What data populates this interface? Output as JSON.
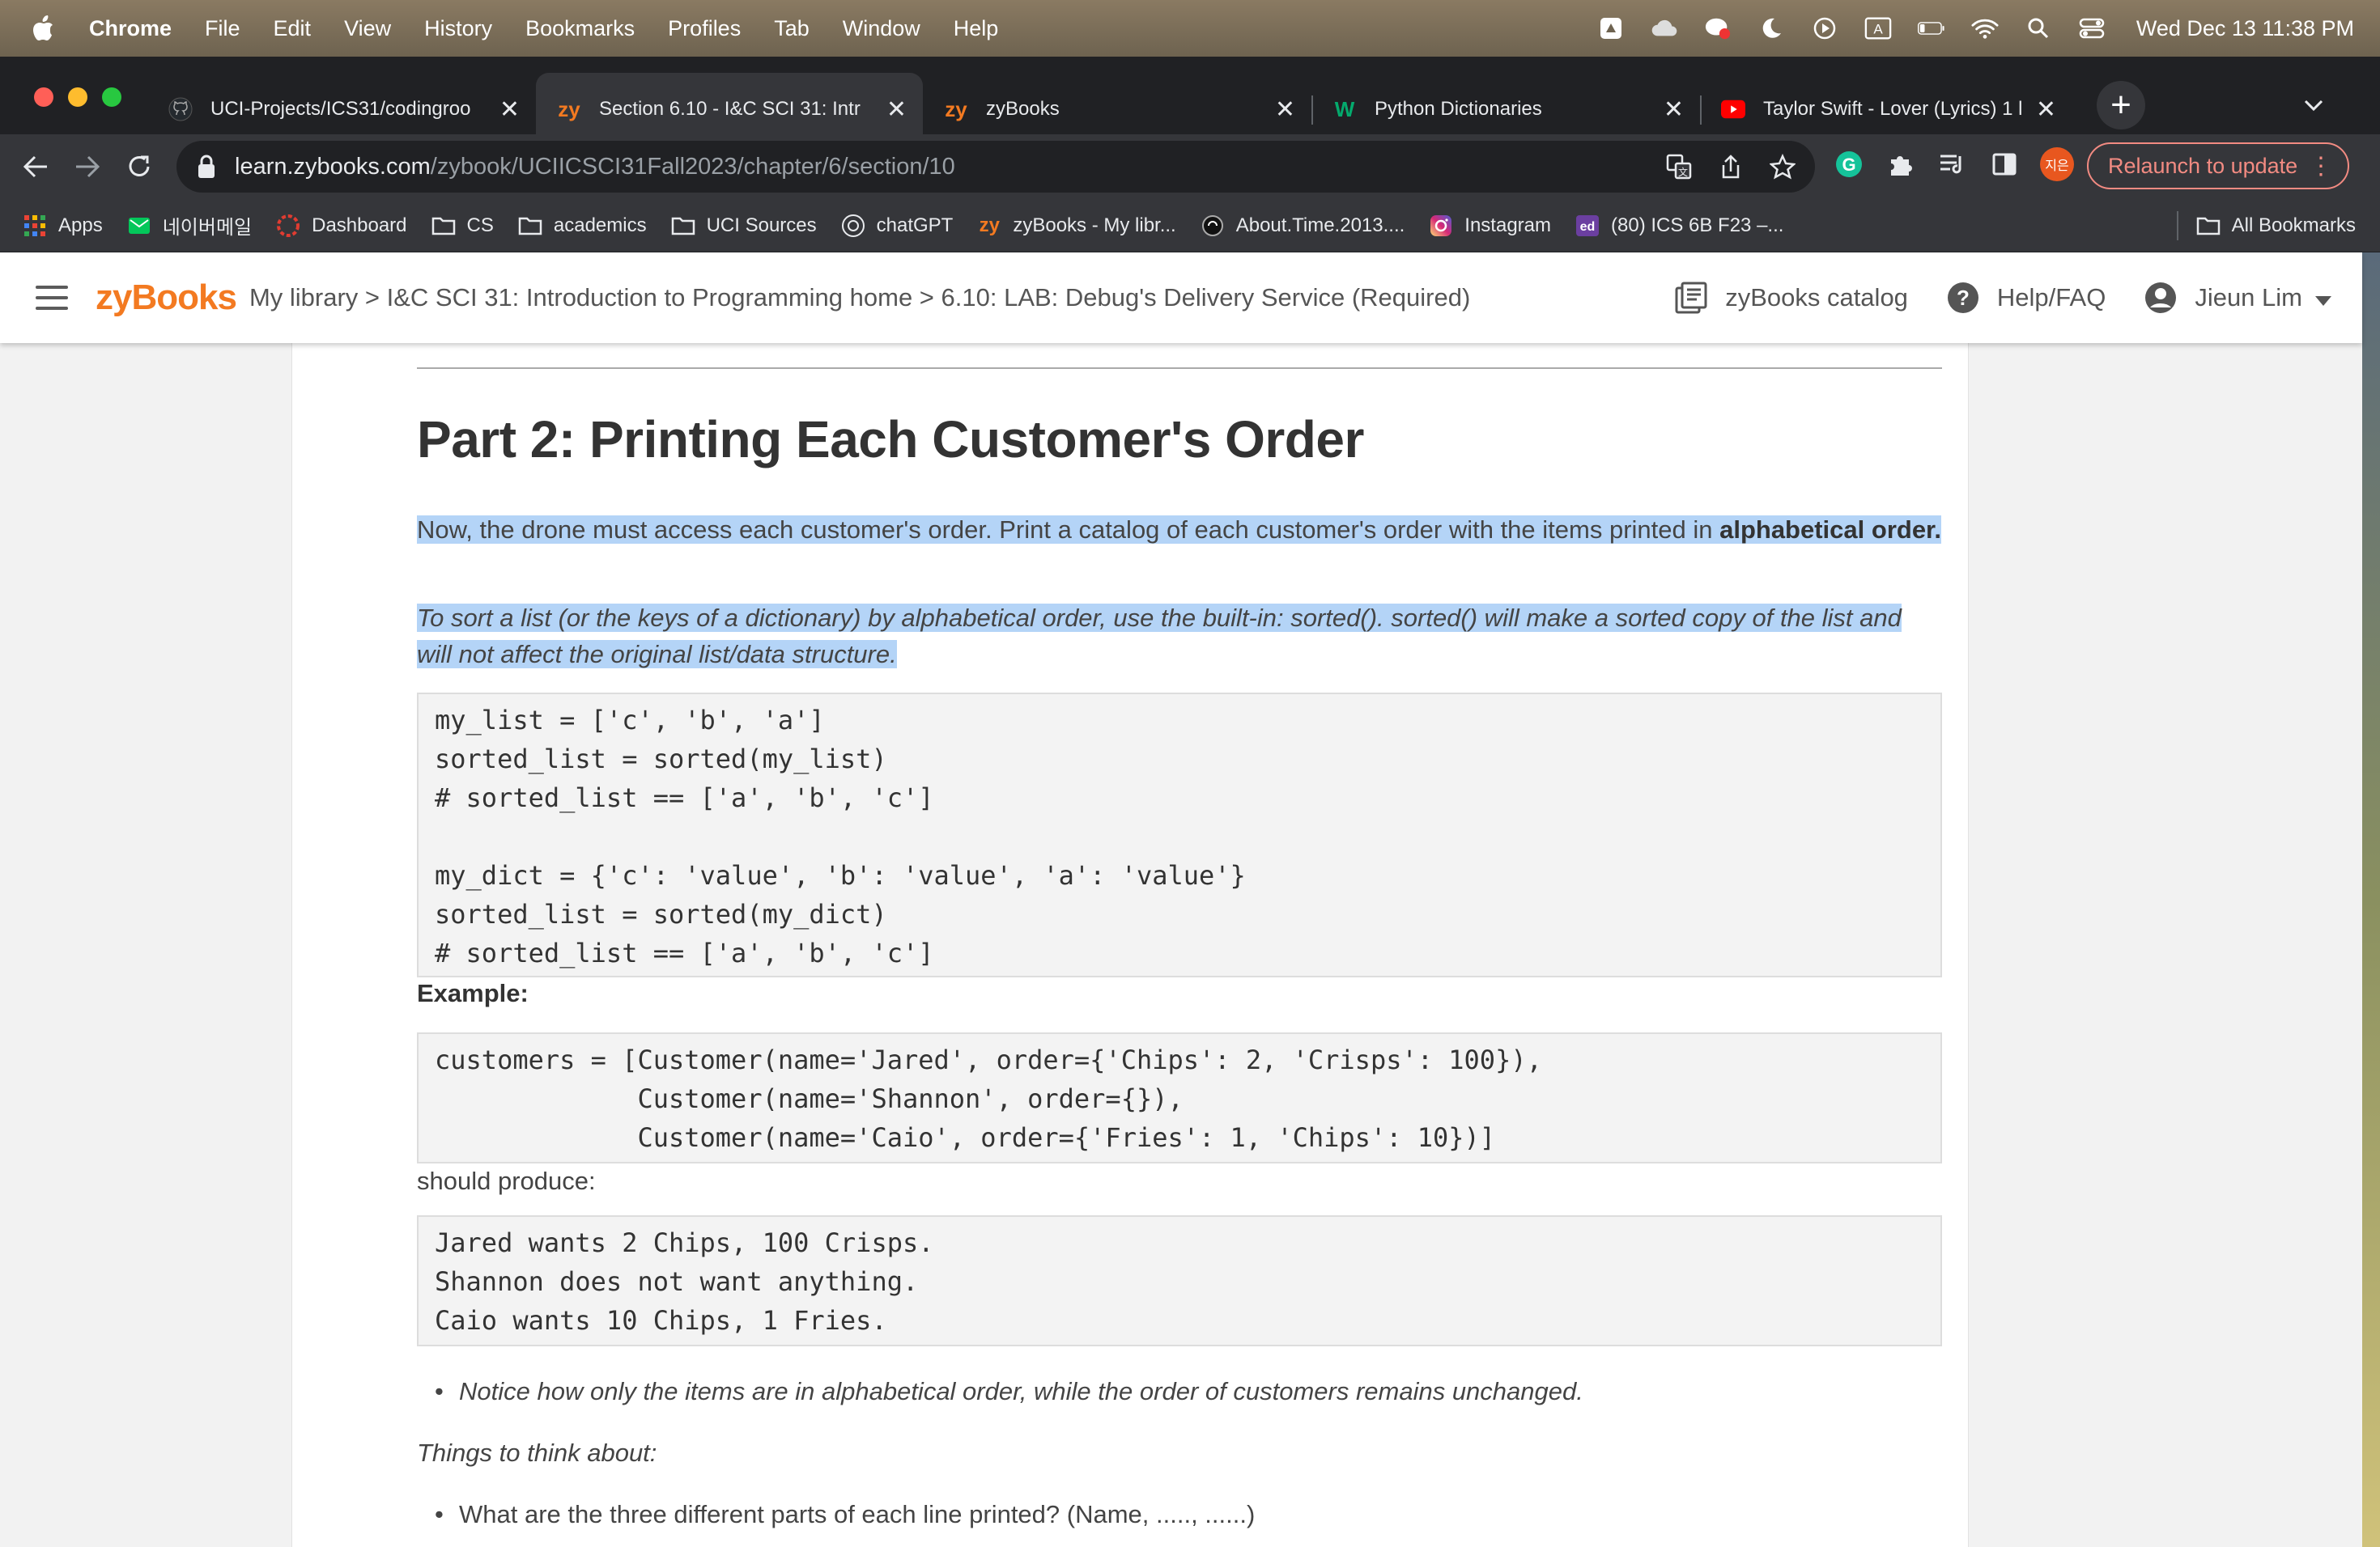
{
  "menubar": {
    "app": "Chrome",
    "items": [
      "File",
      "Edit",
      "View",
      "History",
      "Bookmarks",
      "Profiles",
      "Tab",
      "Window",
      "Help"
    ],
    "clock": "Wed Dec 13  11:38 PM"
  },
  "tabs": [
    {
      "title": "UCI-Projects/ICS31/codingroo",
      "icon": "github-icon"
    },
    {
      "title": "Section 6.10 - I&C SCI 31: Intr",
      "icon": "zybooks-icon",
      "active": true
    },
    {
      "title": "zyBooks",
      "icon": "zybooks-icon"
    },
    {
      "title": "Python Dictionaries",
      "icon": "w3schools-icon"
    },
    {
      "title": "Taylor Swift - Lover (Lyrics) 1 l",
      "icon": "youtube-icon"
    }
  ],
  "omnibox": {
    "host": "learn.zybooks.com",
    "path": "/zybook/UCIICSCI31Fall2023/chapter/6/section/10"
  },
  "toolbar": {
    "relaunch_label": "Relaunch to update",
    "profile_initials": "지은"
  },
  "bookmarks": [
    {
      "label": "Apps",
      "icon": "apps-grid-icon"
    },
    {
      "label": "네이버메일",
      "icon": "naver-mail-icon"
    },
    {
      "label": "Dashboard",
      "icon": "dashboard-icon"
    },
    {
      "label": "CS",
      "icon": "folder-icon"
    },
    {
      "label": "academics",
      "icon": "folder-icon"
    },
    {
      "label": "UCI Sources",
      "icon": "folder-icon"
    },
    {
      "label": "chatGPT",
      "icon": "openai-icon"
    },
    {
      "label": "zyBooks - My libr...",
      "icon": "zybooks-icon"
    },
    {
      "label": "About.Time.2013....",
      "icon": "film-icon"
    },
    {
      "label": "Instagram",
      "icon": "instagram-icon"
    },
    {
      "label": "(80) ICS 6B F23 –...",
      "icon": "ed-icon"
    }
  ],
  "all_bookmarks_label": "All Bookmarks",
  "zyheader": {
    "logo": "zyBooks",
    "breadcrumb": "My library > I&C SCI 31: Introduction to Programming home > 6.10: LAB: Debug's Delivery Service (Required)",
    "catalog_label": "zyBooks catalog",
    "help_label": "Help/FAQ",
    "user_name": "Jieun Lim"
  },
  "content": {
    "heading": "Part 2: Printing Each Customer's Order",
    "para1_normal": "Now, the drone must access each customer's order. Print a catalog of each customer's order with the items printed in ",
    "para1_bold": "alphabetical order.",
    "para2": "To sort a list (or the keys of a dictionary) by alphabetical order, use the built-in: sorted(). sorted() will make a sorted copy of the list and will not affect the original list/data structure.",
    "code1": "my_list = ['c', 'b', 'a']\nsorted_list = sorted(my_list)\n# sorted_list == ['a', 'b', 'c']\n\nmy_dict = {'c': 'value', 'b': 'value', 'a': 'value'}\nsorted_list = sorted(my_dict)\n# sorted_list == ['a', 'b', 'c']",
    "example_label": "Example:",
    "code2": "customers = [Customer(name='Jared', order={'Chips': 2, 'Crisps': 100}),\n             Customer(name='Shannon', order={}),\n             Customer(name='Caio', order={'Fries': 1, 'Chips': 10})]",
    "should_produce_label": "should produce:",
    "code3": "Jared wants 2 Chips, 100 Crisps.\nShannon does not want anything.\nCaio wants 10 Chips, 1 Fries.",
    "bullet1": "Notice how only the items are in alphabetical order, while the order of customers remains unchanged.",
    "things_label": "Things to think about:",
    "bullet2": "What are the three different parts of each line printed? (Name, ....., ......)"
  }
}
